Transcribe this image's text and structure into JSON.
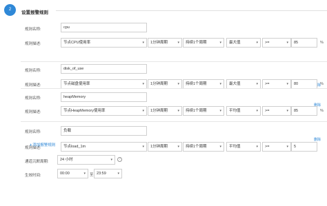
{
  "header": {
    "step": "2",
    "title": "设置报警规则"
  },
  "labels": {
    "rule_name": "规则名称:",
    "rule_desc": "规则描述:"
  },
  "rules": [
    {
      "name": "cpu",
      "metric": "节点CPU使用率",
      "period": "1分钟周期",
      "duration": "持续1个周期",
      "aggregation": "最大值",
      "operator": ">=",
      "threshold": "85",
      "unit": "%",
      "deletable": false
    },
    {
      "name": "disk_of_use",
      "metric": "节点磁盘使用率",
      "period": "1分钟周期",
      "duration": "持续1个周期",
      "aggregation": "最大值",
      "operator": ">=",
      "threshold": "80",
      "unit": "%",
      "deletable": true
    },
    {
      "name": "heapMemory",
      "metric": "节点HeapMemory使用率",
      "period": "1分钟周期",
      "duration": "持续1个周期",
      "aggregation": "平均值",
      "operator": ">=",
      "threshold": "85",
      "unit": "%",
      "deletable": true
    },
    {
      "name": "负载",
      "metric": "节点load_1m",
      "period": "1分钟周期",
      "duration": "持续1个周期",
      "aggregation": "平均值",
      "operator": ">=",
      "threshold": "5",
      "unit": "",
      "deletable": true
    }
  ],
  "delete_label": "删除",
  "add_rule_label": "添加报警规则",
  "silence": {
    "label": "通道沉默周期:",
    "value": "24 小时"
  },
  "effective": {
    "label": "生效时间:",
    "start": "00:00",
    "separator": "至",
    "end": "23:59"
  }
}
